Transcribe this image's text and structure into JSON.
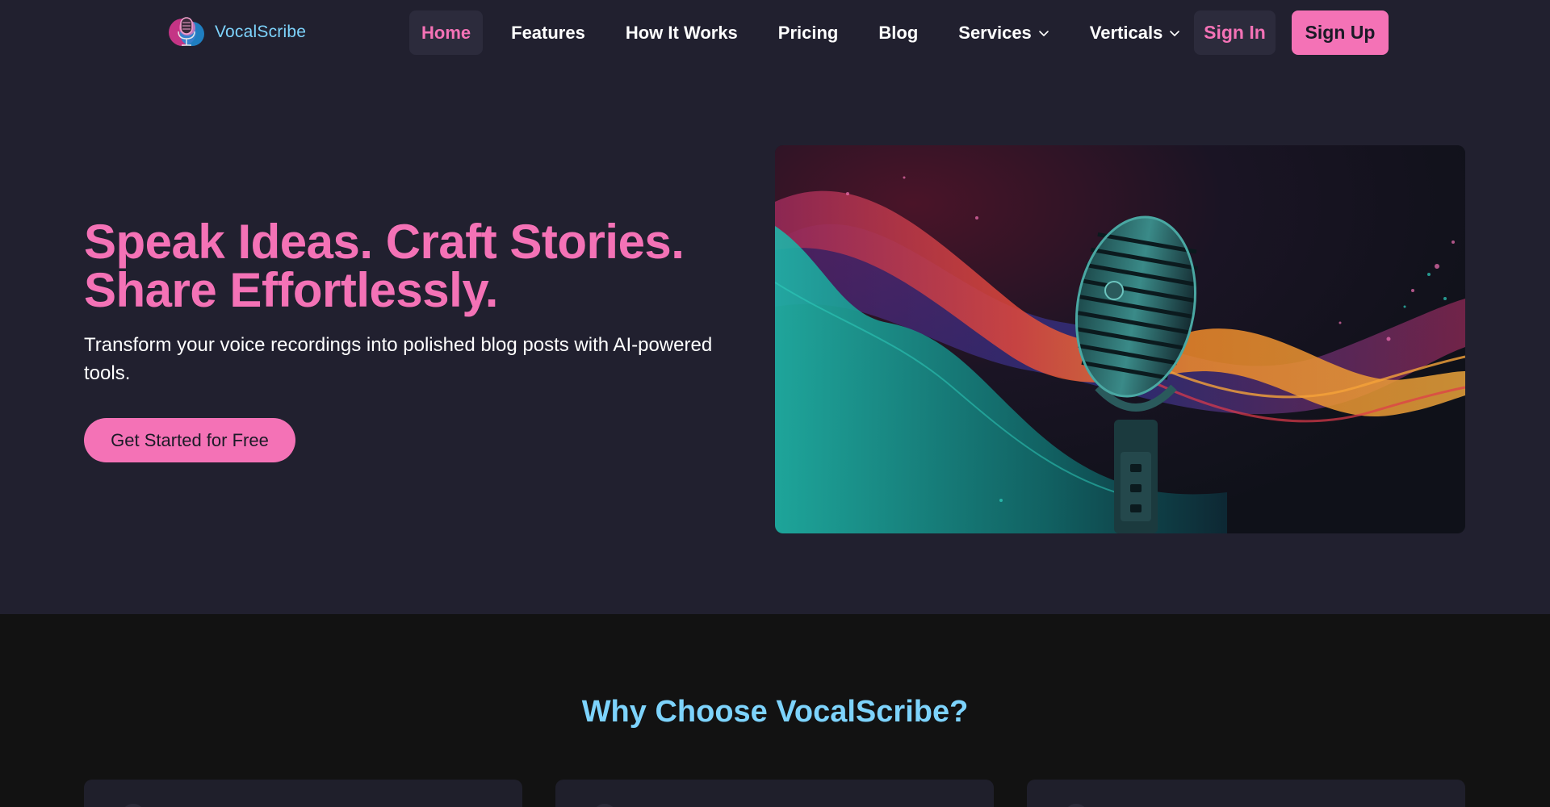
{
  "nav": {
    "logo_text": "VocalScribe",
    "links": [
      {
        "label": "Home",
        "active": true
      },
      {
        "label": "Features"
      },
      {
        "label": "How It Works"
      },
      {
        "label": "Pricing"
      },
      {
        "label": "Blog"
      },
      {
        "label": "Services",
        "dropdown": true
      },
      {
        "label": "Verticals",
        "dropdown": true
      }
    ],
    "sign_in": "Sign In",
    "sign_up": "Sign Up"
  },
  "hero": {
    "title_line1": "Speak Ideas. Craft Stories.",
    "title_line2": "Share Effortlessly.",
    "subtitle": "Transform your voice recordings into polished blog posts with AI-powered tools.",
    "cta": "Get Started for Free"
  },
  "why": {
    "title": "Why Choose VocalScribe?"
  },
  "colors": {
    "background": "#21202f",
    "accent_pink": "#f472b6",
    "accent_cyan": "#7dd3fc",
    "section_dark": "#121212"
  }
}
